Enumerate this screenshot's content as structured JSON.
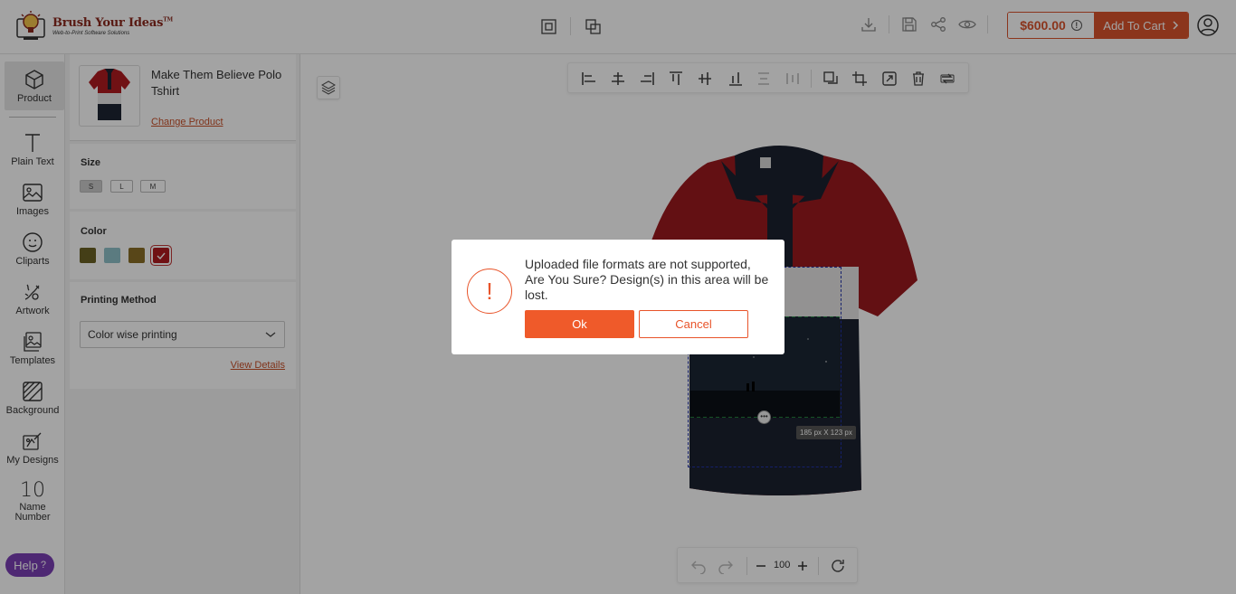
{
  "header": {
    "brand_name": "Brush Your Ideas",
    "brand_tm": "TM",
    "brand_tagline": "Web-to-Print Software Solutions",
    "price": "$600.00",
    "add_to_cart": "Add To Cart"
  },
  "rail": {
    "items": [
      {
        "label": "Product",
        "icon": "cube-icon"
      },
      {
        "label": "Plain Text",
        "icon": "text-icon"
      },
      {
        "label": "Images",
        "icon": "image-icon"
      },
      {
        "label": "Cliparts",
        "icon": "smiley-icon"
      },
      {
        "label": "Artwork",
        "icon": "artwork-icon"
      },
      {
        "label": "Templates",
        "icon": "templates-icon"
      },
      {
        "label": "Background",
        "icon": "background-icon"
      },
      {
        "label": "My Designs",
        "icon": "my-designs-icon"
      },
      {
        "label": "Name Number",
        "icon": "name-number-icon",
        "number": "10"
      }
    ],
    "help": "Help"
  },
  "panel": {
    "product_name": "Make Them Believe Polo Tshirt",
    "change_product": "Change Product",
    "size_title": "Size",
    "sizes": [
      "S",
      "L",
      "M"
    ],
    "selected_size": "S",
    "color_title": "Color",
    "colors": [
      "#6b6224",
      "#8fc0c8",
      "#8a6e26",
      "#b01c20"
    ],
    "selected_color": "#b01c20",
    "printing_title": "Printing Method",
    "printing_value": "Color wise printing",
    "view_details": "View Details"
  },
  "canvas": {
    "zoom": "100",
    "dimensions": "185 px X 123 px"
  },
  "dialog": {
    "message": "Uploaded file formats are not supported, Are You Sure? Design(s) in this area will be lost.",
    "ok": "Ok",
    "cancel": "Cancel",
    "icon": "!"
  }
}
